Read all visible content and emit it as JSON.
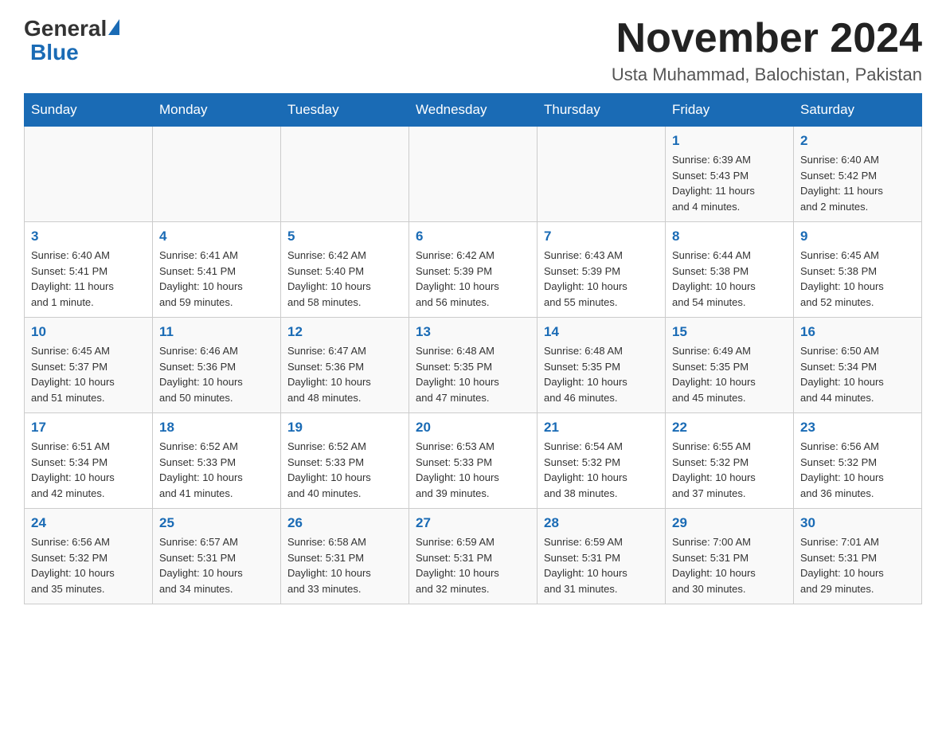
{
  "header": {
    "logo_general": "General",
    "logo_blue": "Blue",
    "month_title": "November 2024",
    "location": "Usta Muhammad, Balochistan, Pakistan"
  },
  "days_of_week": [
    "Sunday",
    "Monday",
    "Tuesday",
    "Wednesday",
    "Thursday",
    "Friday",
    "Saturday"
  ],
  "weeks": [
    [
      {
        "day": "",
        "info": ""
      },
      {
        "day": "",
        "info": ""
      },
      {
        "day": "",
        "info": ""
      },
      {
        "day": "",
        "info": ""
      },
      {
        "day": "",
        "info": ""
      },
      {
        "day": "1",
        "info": "Sunrise: 6:39 AM\nSunset: 5:43 PM\nDaylight: 11 hours\nand 4 minutes."
      },
      {
        "day": "2",
        "info": "Sunrise: 6:40 AM\nSunset: 5:42 PM\nDaylight: 11 hours\nand 2 minutes."
      }
    ],
    [
      {
        "day": "3",
        "info": "Sunrise: 6:40 AM\nSunset: 5:41 PM\nDaylight: 11 hours\nand 1 minute."
      },
      {
        "day": "4",
        "info": "Sunrise: 6:41 AM\nSunset: 5:41 PM\nDaylight: 10 hours\nand 59 minutes."
      },
      {
        "day": "5",
        "info": "Sunrise: 6:42 AM\nSunset: 5:40 PM\nDaylight: 10 hours\nand 58 minutes."
      },
      {
        "day": "6",
        "info": "Sunrise: 6:42 AM\nSunset: 5:39 PM\nDaylight: 10 hours\nand 56 minutes."
      },
      {
        "day": "7",
        "info": "Sunrise: 6:43 AM\nSunset: 5:39 PM\nDaylight: 10 hours\nand 55 minutes."
      },
      {
        "day": "8",
        "info": "Sunrise: 6:44 AM\nSunset: 5:38 PM\nDaylight: 10 hours\nand 54 minutes."
      },
      {
        "day": "9",
        "info": "Sunrise: 6:45 AM\nSunset: 5:38 PM\nDaylight: 10 hours\nand 52 minutes."
      }
    ],
    [
      {
        "day": "10",
        "info": "Sunrise: 6:45 AM\nSunset: 5:37 PM\nDaylight: 10 hours\nand 51 minutes."
      },
      {
        "day": "11",
        "info": "Sunrise: 6:46 AM\nSunset: 5:36 PM\nDaylight: 10 hours\nand 50 minutes."
      },
      {
        "day": "12",
        "info": "Sunrise: 6:47 AM\nSunset: 5:36 PM\nDaylight: 10 hours\nand 48 minutes."
      },
      {
        "day": "13",
        "info": "Sunrise: 6:48 AM\nSunset: 5:35 PM\nDaylight: 10 hours\nand 47 minutes."
      },
      {
        "day": "14",
        "info": "Sunrise: 6:48 AM\nSunset: 5:35 PM\nDaylight: 10 hours\nand 46 minutes."
      },
      {
        "day": "15",
        "info": "Sunrise: 6:49 AM\nSunset: 5:35 PM\nDaylight: 10 hours\nand 45 minutes."
      },
      {
        "day": "16",
        "info": "Sunrise: 6:50 AM\nSunset: 5:34 PM\nDaylight: 10 hours\nand 44 minutes."
      }
    ],
    [
      {
        "day": "17",
        "info": "Sunrise: 6:51 AM\nSunset: 5:34 PM\nDaylight: 10 hours\nand 42 minutes."
      },
      {
        "day": "18",
        "info": "Sunrise: 6:52 AM\nSunset: 5:33 PM\nDaylight: 10 hours\nand 41 minutes."
      },
      {
        "day": "19",
        "info": "Sunrise: 6:52 AM\nSunset: 5:33 PM\nDaylight: 10 hours\nand 40 minutes."
      },
      {
        "day": "20",
        "info": "Sunrise: 6:53 AM\nSunset: 5:33 PM\nDaylight: 10 hours\nand 39 minutes."
      },
      {
        "day": "21",
        "info": "Sunrise: 6:54 AM\nSunset: 5:32 PM\nDaylight: 10 hours\nand 38 minutes."
      },
      {
        "day": "22",
        "info": "Sunrise: 6:55 AM\nSunset: 5:32 PM\nDaylight: 10 hours\nand 37 minutes."
      },
      {
        "day": "23",
        "info": "Sunrise: 6:56 AM\nSunset: 5:32 PM\nDaylight: 10 hours\nand 36 minutes."
      }
    ],
    [
      {
        "day": "24",
        "info": "Sunrise: 6:56 AM\nSunset: 5:32 PM\nDaylight: 10 hours\nand 35 minutes."
      },
      {
        "day": "25",
        "info": "Sunrise: 6:57 AM\nSunset: 5:31 PM\nDaylight: 10 hours\nand 34 minutes."
      },
      {
        "day": "26",
        "info": "Sunrise: 6:58 AM\nSunset: 5:31 PM\nDaylight: 10 hours\nand 33 minutes."
      },
      {
        "day": "27",
        "info": "Sunrise: 6:59 AM\nSunset: 5:31 PM\nDaylight: 10 hours\nand 32 minutes."
      },
      {
        "day": "28",
        "info": "Sunrise: 6:59 AM\nSunset: 5:31 PM\nDaylight: 10 hours\nand 31 minutes."
      },
      {
        "day": "29",
        "info": "Sunrise: 7:00 AM\nSunset: 5:31 PM\nDaylight: 10 hours\nand 30 minutes."
      },
      {
        "day": "30",
        "info": "Sunrise: 7:01 AM\nSunset: 5:31 PM\nDaylight: 10 hours\nand 29 minutes."
      }
    ]
  ]
}
